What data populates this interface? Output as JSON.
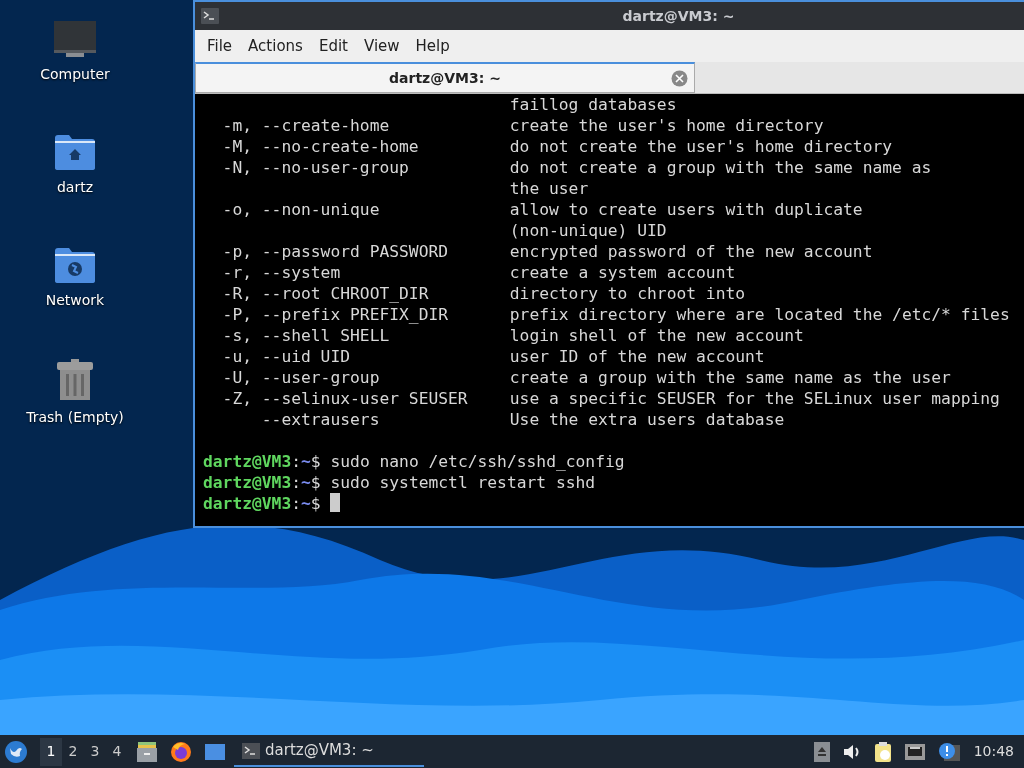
{
  "desktop_icons": [
    {
      "kind": "computer",
      "label": "Computer"
    },
    {
      "kind": "home",
      "label": "dartz"
    },
    {
      "kind": "network",
      "label": "Network"
    },
    {
      "kind": "trash",
      "label": "Trash (Empty)"
    }
  ],
  "window": {
    "title": "dartz@VM3: ~",
    "menu": [
      "File",
      "Actions",
      "Edit",
      "View",
      "Help"
    ],
    "tabs": [
      {
        "label": "dartz@VM3: ~",
        "selected": true
      }
    ],
    "terminal": {
      "lines": [
        {
          "kind": "option",
          "description": "faillog databases"
        },
        {
          "kind": "option",
          "option": "-m, --create-home",
          "description": "create the user's home directory"
        },
        {
          "kind": "option",
          "option": "-M, --no-create-home",
          "description": "do not create the user's home directory"
        },
        {
          "kind": "option",
          "option": "-N, --no-user-group",
          "description": "do not create a group with the same name as"
        },
        {
          "kind": "option",
          "description": "the user"
        },
        {
          "kind": "option",
          "option": "-o, --non-unique",
          "description": "allow to create users with duplicate"
        },
        {
          "kind": "option",
          "description": "(non-unique) UID"
        },
        {
          "kind": "option",
          "option": "-p, --password PASSWORD",
          "description": "encrypted password of the new account"
        },
        {
          "kind": "option",
          "option": "-r, --system",
          "description": "create a system account"
        },
        {
          "kind": "option",
          "option": "-R, --root CHROOT_DIR",
          "description": "directory to chroot into"
        },
        {
          "kind": "option",
          "option": "-P, --prefix PREFIX_DIR",
          "description": "prefix directory where are located the /etc/* files"
        },
        {
          "kind": "option",
          "option": "-s, --shell SHELL",
          "description": "login shell of the new account"
        },
        {
          "kind": "option",
          "option": "-u, --uid UID",
          "description": "user ID of the new account"
        },
        {
          "kind": "option",
          "option": "-U, --user-group",
          "description": "create a group with the same name as the user"
        },
        {
          "kind": "option",
          "option": "-Z, --selinux-user SEUSER",
          "description": "use a specific SEUSER for the SELinux user mapping"
        },
        {
          "kind": "option",
          "option": "    --extrausers",
          "description": "Use the extra users database"
        },
        {
          "kind": "blank"
        },
        {
          "kind": "prompt",
          "user": "dartz@VM3",
          "sep": ":",
          "path": "~",
          "symbol": "$",
          "command": "sudo nano /etc/ssh/sshd_config"
        },
        {
          "kind": "prompt",
          "user": "dartz@VM3",
          "sep": ":",
          "path": "~",
          "symbol": "$",
          "command": "sudo systemctl restart sshd"
        },
        {
          "kind": "prompt",
          "user": "dartz@VM3",
          "sep": ":",
          "path": "~",
          "symbol": "$",
          "cursor": true
        }
      ]
    }
  },
  "taskbar": {
    "workspaces": [
      {
        "label": "1",
        "selected": true
      },
      {
        "label": "2",
        "selected": false
      },
      {
        "label": "3",
        "selected": false
      },
      {
        "label": "4",
        "selected": false
      }
    ],
    "launchers": [
      {
        "kind": "files"
      },
      {
        "kind": "browser"
      },
      {
        "kind": "desktop"
      }
    ],
    "tasks": [
      {
        "label": "dartz@VM3: ~",
        "selected": true
      }
    ],
    "tray": [
      {
        "kind": "eject"
      },
      {
        "kind": "volume"
      },
      {
        "kind": "clipboard"
      },
      {
        "kind": "network"
      },
      {
        "kind": "notify"
      }
    ],
    "clock": "10:48"
  }
}
